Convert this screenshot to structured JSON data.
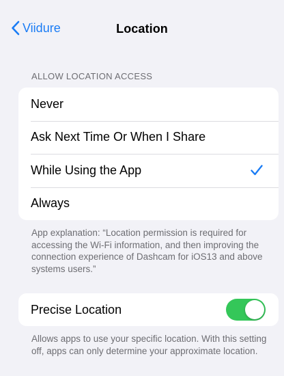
{
  "nav": {
    "back_label": "Viidure",
    "title": "Location"
  },
  "access": {
    "header": "ALLOW LOCATION ACCESS",
    "options": [
      {
        "label": "Never",
        "selected": false
      },
      {
        "label": "Ask Next Time Or When I Share",
        "selected": false
      },
      {
        "label": "While Using the App",
        "selected": true
      },
      {
        "label": "Always",
        "selected": false
      }
    ],
    "explanation": "App explanation: “Location permission is required for accessing the Wi-Fi information, and then improving the connection experience of Dashcam for iOS13 and above systems users.”"
  },
  "precise": {
    "label": "Precise Location",
    "enabled": true,
    "description": "Allows apps to use your specific location. With this setting off, apps can only determine your approximate location."
  },
  "colors": {
    "accent": "#1a7cf5",
    "toggle_on": "#34c759",
    "background": "#f2f2f7"
  },
  "icons": {
    "back": "chevron-left-icon",
    "selected": "checkmark-icon"
  }
}
